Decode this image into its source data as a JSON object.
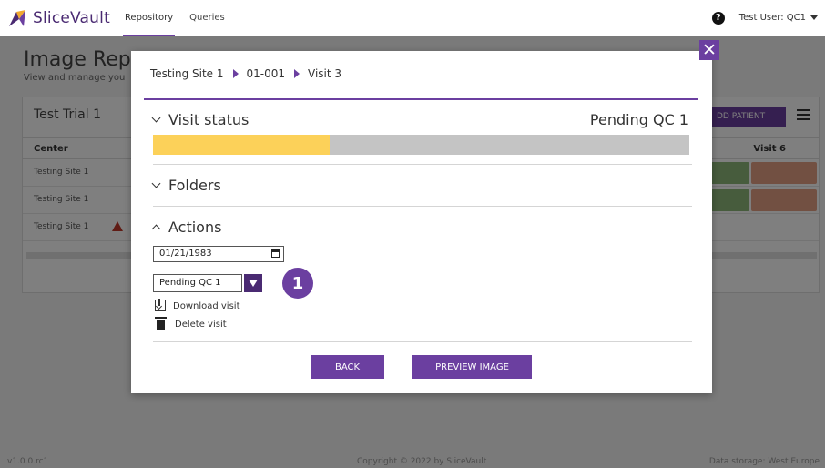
{
  "app": {
    "brand_name": "SliceVault",
    "nav_tabs": [
      {
        "label": "Repository",
        "active": true
      },
      {
        "label": "Queries",
        "active": false
      }
    ],
    "help_icon": "question-circle-icon",
    "help_glyph": "?",
    "user_label": "Test User: QC1"
  },
  "background": {
    "page_title": "Image Repo",
    "page_subtitle": "View and manage you",
    "trial_title": "Test Trial 1",
    "add_patient_label": "DD PATIENT",
    "col_center": "Center",
    "col_visit6": "Visit 6",
    "rows": [
      {
        "center": "Testing Site 1",
        "warning": false
      },
      {
        "center": "Testing Site 1",
        "warning": false
      },
      {
        "center": "Testing Site 1",
        "warning": true
      }
    ],
    "footer_left": "v1.0.0.rc1",
    "footer_center": "Copyright © 2022 by SliceVault",
    "footer_right": "Data storage: West Europe"
  },
  "modal": {
    "close_glyph": "✕",
    "breadcrumb": [
      "Testing Site 1",
      "01-001",
      "Visit 3"
    ],
    "visit_status": {
      "title": "Visit status",
      "value": "Pending QC 1",
      "progress_percent": 33
    },
    "folders": {
      "title": "Folders"
    },
    "actions": {
      "title": "Actions",
      "date_value": "01/21/1983",
      "status_selected": "Pending QC 1",
      "step_badge": "1",
      "download_label": "Download visit",
      "delete_label": "Delete visit"
    },
    "buttons": {
      "back": "BACK",
      "preview": "PREVIEW IMAGE"
    }
  },
  "colors": {
    "accent": "#6b3fa0",
    "accent_dark": "#4a2a72",
    "progress_fill": "#fcd159",
    "progress_track": "#c4c4c4",
    "cell_green": "#8fb87a",
    "cell_salmon": "#e5a084",
    "warning": "#c0392b"
  }
}
